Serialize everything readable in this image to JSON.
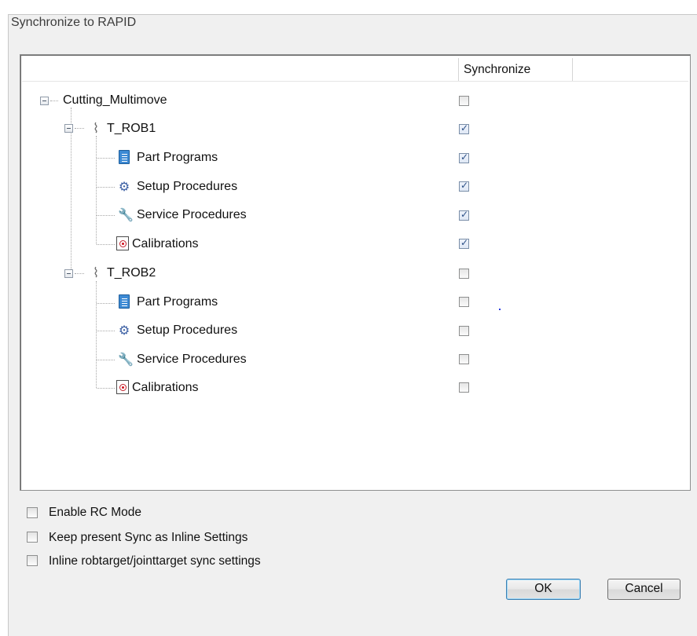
{
  "window": {
    "title": "Synchronize to RAPID"
  },
  "tree": {
    "column_header": "Synchronize",
    "root": {
      "label": "Cutting_Multimove",
      "checked": false
    },
    "robots": [
      {
        "label": "T_ROB1",
        "checked": true,
        "children": [
          {
            "label": "Part Programs",
            "icon": "document-icon",
            "checked": true
          },
          {
            "label": "Setup Procedures",
            "icon": "gear-icon",
            "checked": true
          },
          {
            "label": "Service Procedures",
            "icon": "wrench-icon",
            "checked": true
          },
          {
            "label": "Calibrations",
            "icon": "target-icon",
            "checked": true
          }
        ]
      },
      {
        "label": "T_ROB2",
        "checked": false,
        "children": [
          {
            "label": "Part Programs",
            "icon": "document-icon",
            "checked": false
          },
          {
            "label": "Setup Procedures",
            "icon": "gear-icon",
            "checked": false
          },
          {
            "label": "Service Procedures",
            "icon": "wrench-icon",
            "checked": false
          },
          {
            "label": "Calibrations",
            "icon": "target-icon",
            "checked": false
          }
        ]
      }
    ]
  },
  "options": {
    "enable_rc_mode": {
      "label": "Enable RC Mode",
      "checked": false
    },
    "keep_sync_inline": {
      "label": "Keep present Sync as Inline Settings",
      "checked": false
    },
    "inline_target_sync": {
      "label": "Inline robtarget/jointtarget sync settings",
      "checked": false
    }
  },
  "buttons": {
    "ok": "OK",
    "cancel": "Cancel"
  }
}
